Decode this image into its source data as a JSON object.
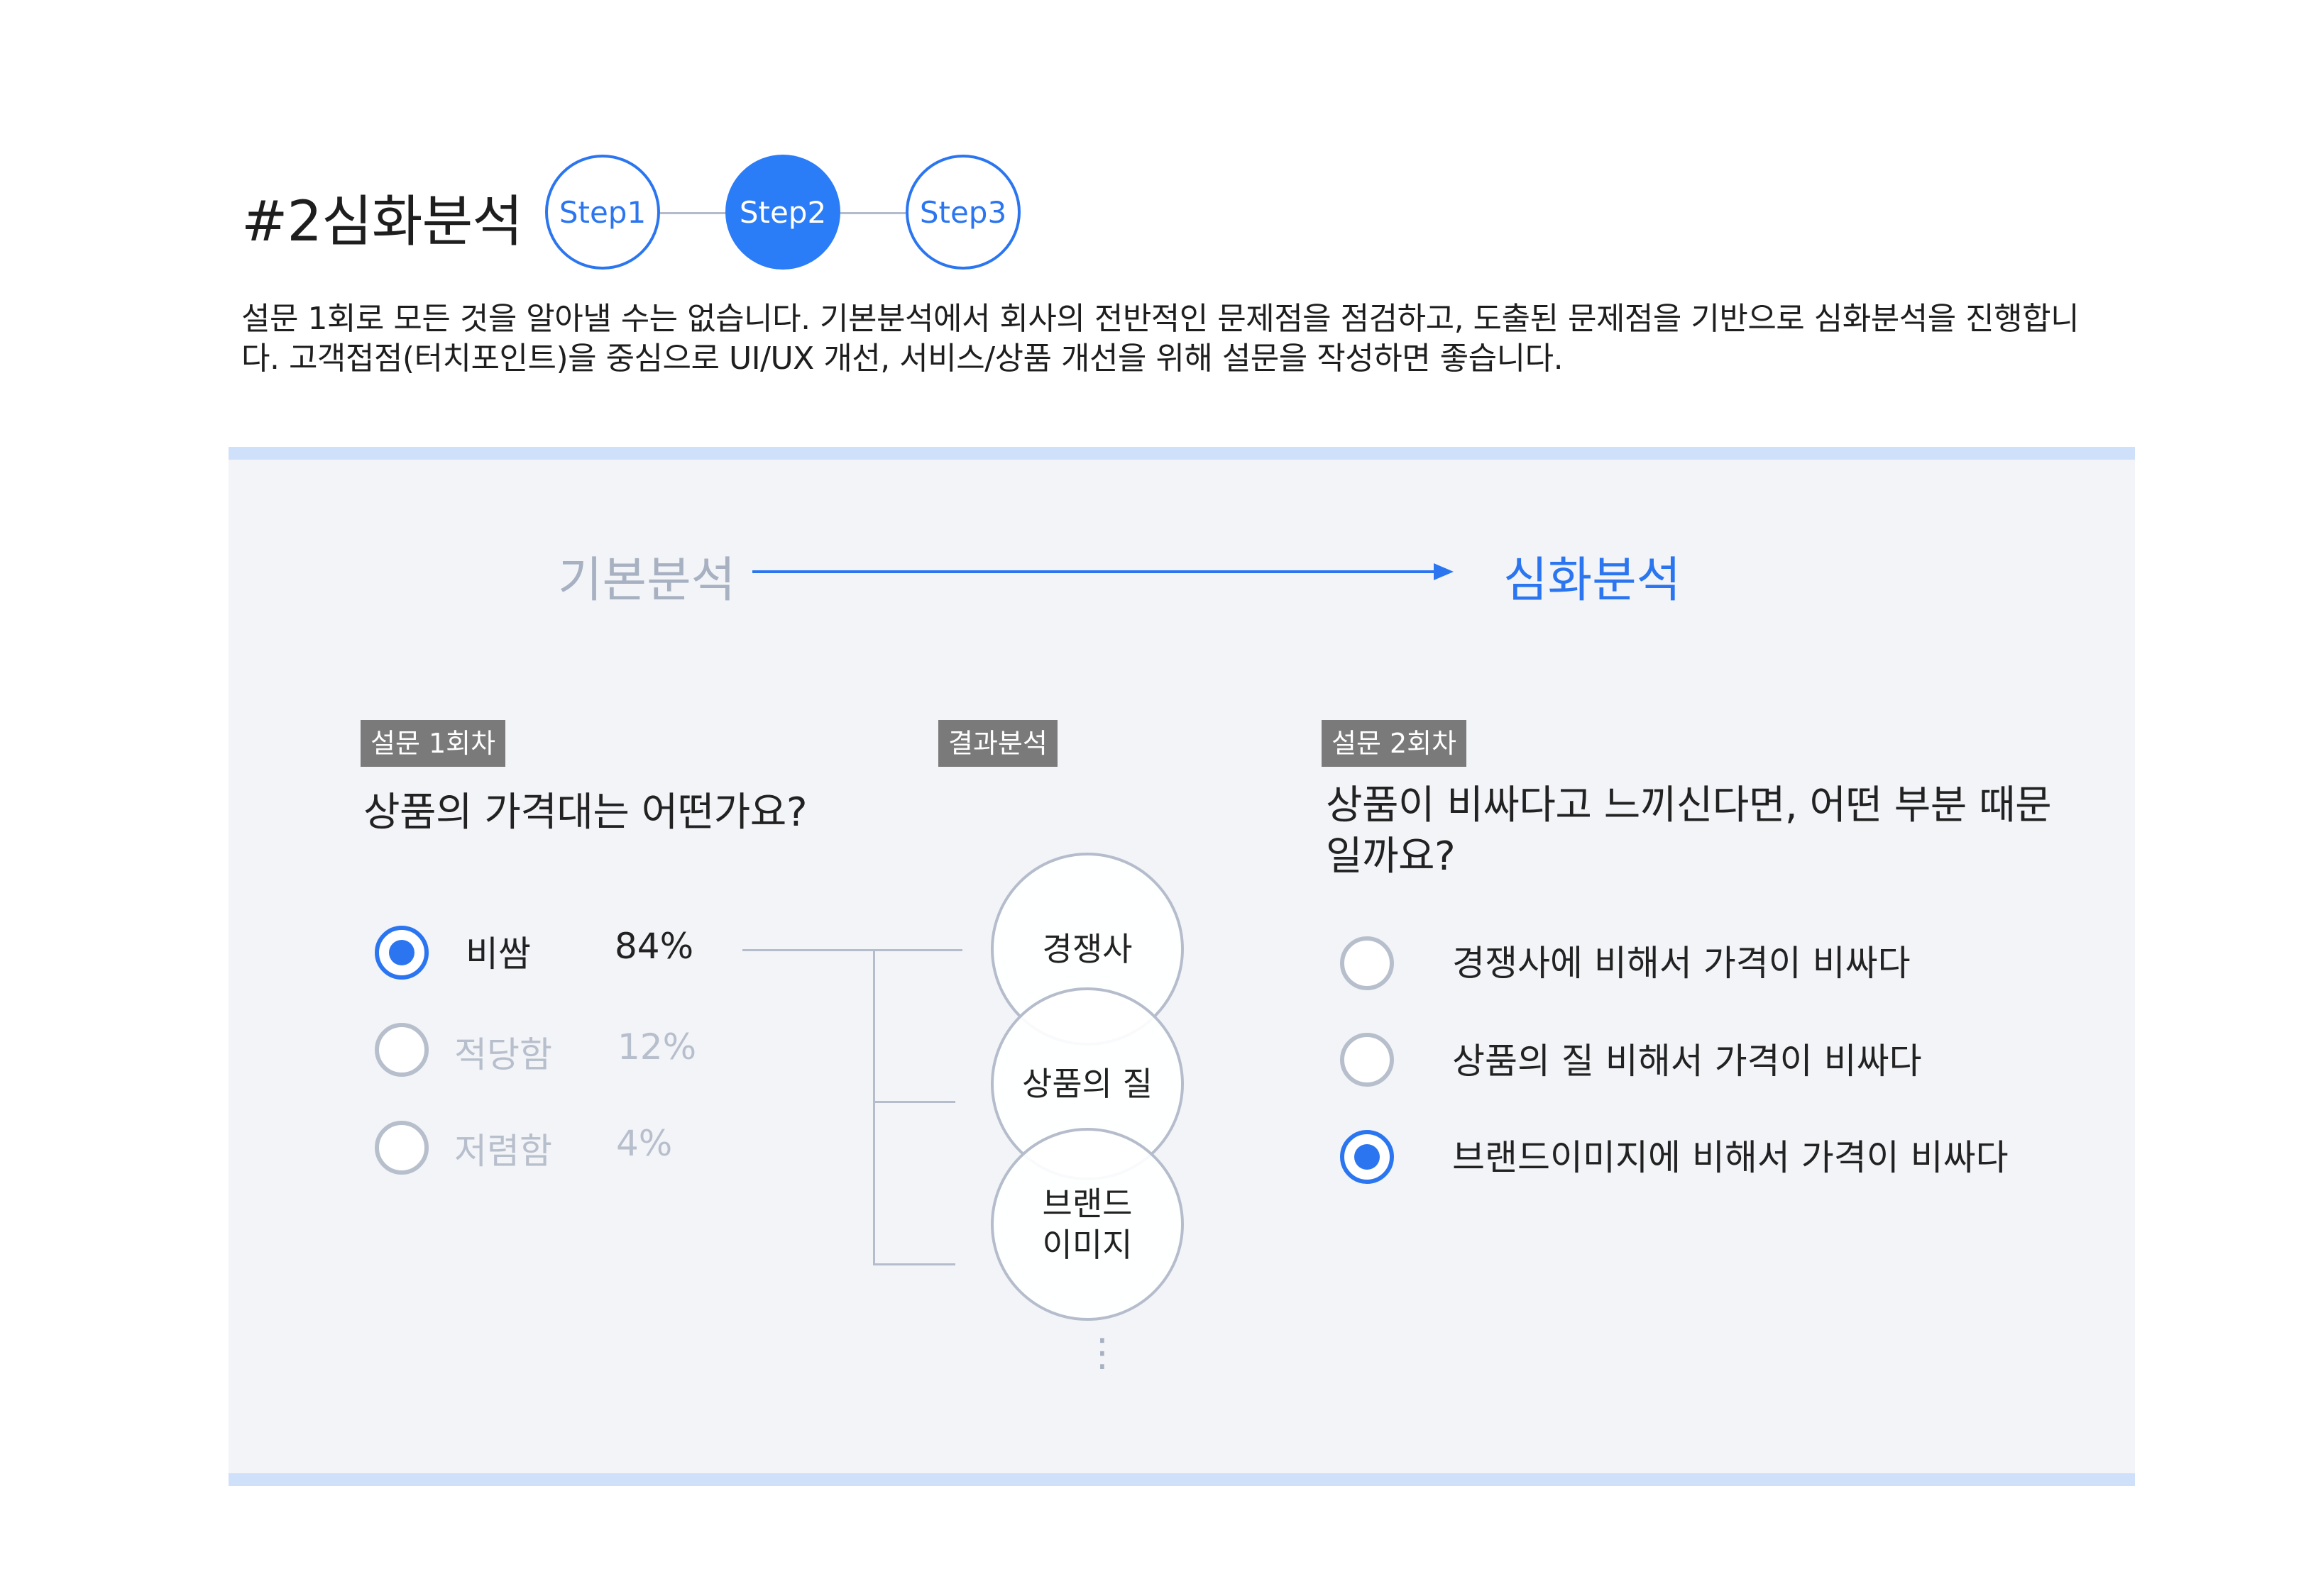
{
  "header": {
    "title": "#2심화분석",
    "steps": [
      "Step1",
      "Step2",
      "Step3"
    ],
    "active_step": 2,
    "description": "설문 1회로 모든 것을 알아낼 수는 없습니다. 기본분석에서 회사의 전반적인 문제점을 점검하고, 도출된 문제점을 기반으로 심화분석을 진행합니다. 고객접점(터치포인트)을 중심으로 UI/UX 개선, 서비스/상품 개선을 위해 설문을 작성하면 좋습니다."
  },
  "flow": {
    "from_label": "기본분석",
    "to_label": "심화분석"
  },
  "survey1": {
    "tag": "설문 1회차",
    "question": "상품의 가격대는 어떤가요?",
    "options": [
      {
        "label": "비쌈",
        "percent": "84%",
        "selected": true
      },
      {
        "label": "적당함",
        "percent": "12%",
        "selected": false
      },
      {
        "label": "저렴함",
        "percent": "4%",
        "selected": false
      }
    ]
  },
  "analysis": {
    "tag": "결과분석",
    "factors": [
      "경쟁사",
      "상품의 질",
      "브랜드\n이미지"
    ],
    "more": "⋮"
  },
  "survey2": {
    "tag": "설문 2회차",
    "question": "상품이 비싸다고 느끼신다면, 어떤 부분 때문일까요?",
    "options": [
      {
        "label": "경쟁사에 비해서 가격이 비싸다",
        "selected": false
      },
      {
        "label": "상품의 질 비해서 가격이 비싸다",
        "selected": false
      },
      {
        "label": "브랜드이미지에 비해서 가격이 비싸다",
        "selected": true
      }
    ]
  },
  "colors": {
    "accent": "#2b76f0",
    "muted": "#a8b1c1",
    "panel": "#f2f4f8",
    "band": "#cfe0fb",
    "tag": "#7a7a7a"
  }
}
